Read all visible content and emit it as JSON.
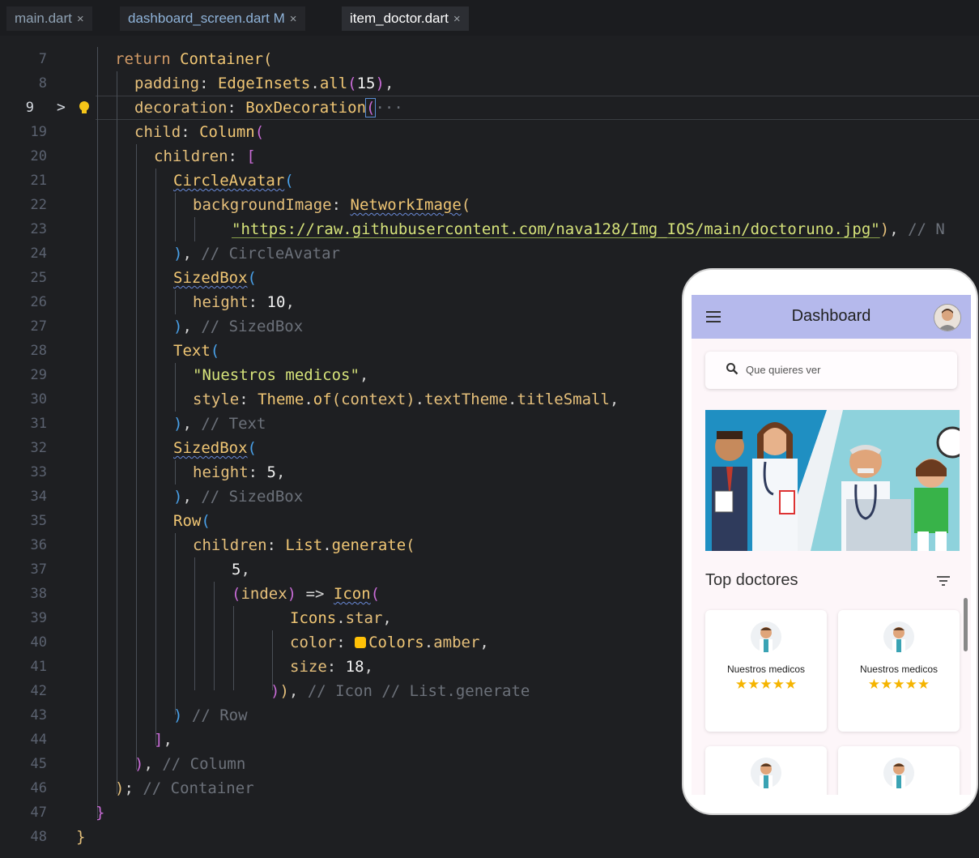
{
  "tabs": [
    {
      "name": "main.dart",
      "modified": false,
      "active": false
    },
    {
      "name": "dashboard_screen.dart",
      "status": "M",
      "modified": true,
      "active": false
    },
    {
      "name": "item_doctor.dart",
      "modified": false,
      "active": true
    }
  ],
  "tab_close_glyph": "×",
  "line_numbers": [
    "7",
    "8",
    "9",
    "19",
    "20",
    "21",
    "22",
    "23",
    "24",
    "25",
    "26",
    "27",
    "28",
    "29",
    "30",
    "31",
    "32",
    "33",
    "34",
    "35",
    "36",
    "37",
    "38",
    "39",
    "40",
    "41",
    "42",
    "43",
    "44",
    "45",
    "46",
    "47",
    "48"
  ],
  "code": {
    "l7": [
      "return",
      "Container",
      "("
    ],
    "l8": [
      "padding",
      ":",
      "EdgeInsets",
      ".",
      "all",
      "(",
      "15",
      ")",
      ","
    ],
    "l9": [
      "decoration",
      ":",
      "BoxDecoration",
      "(",
      "···"
    ],
    "l19": [
      "child",
      ":",
      "Column",
      "("
    ],
    "l20": [
      "children",
      ":",
      "["
    ],
    "l21": [
      "CircleAvatar",
      "("
    ],
    "l22": [
      "backgroundImage",
      ":",
      "NetworkImage",
      "("
    ],
    "l23": [
      "\"https://raw.githubusercontent.com/nava128/Img_IOS/main/doctoruno.jpg\"",
      ")",
      ",",
      "// N"
    ],
    "l24": [
      ")",
      ",",
      "// CircleAvatar"
    ],
    "l25": [
      "SizedBox",
      "("
    ],
    "l26": [
      "height",
      ":",
      "10",
      ","
    ],
    "l27": [
      ")",
      ",",
      "// SizedBox"
    ],
    "l28": [
      "Text",
      "("
    ],
    "l29": [
      "\"Nuestros medicos\"",
      ","
    ],
    "l30": [
      "style",
      ":",
      "Theme",
      ".",
      "of",
      "(",
      "context",
      ")",
      ".",
      "textTheme",
      ".",
      "titleSmall",
      ","
    ],
    "l31": [
      ")",
      ",",
      "// Text"
    ],
    "l32": [
      "SizedBox",
      "("
    ],
    "l33": [
      "height",
      ":",
      "5",
      ","
    ],
    "l34": [
      ")",
      ",",
      "// SizedBox"
    ],
    "l35": [
      "Row",
      "("
    ],
    "l36": [
      "children",
      ":",
      "List",
      ".",
      "generate",
      "("
    ],
    "l37": [
      "5",
      ","
    ],
    "l38": [
      "(",
      "index",
      ")",
      "=>",
      "Icon",
      "("
    ],
    "l39": [
      "Icons",
      ".",
      "star",
      ","
    ],
    "l40": [
      "color",
      ":",
      "Colors",
      ".",
      "amber",
      ","
    ],
    "l41": [
      "size",
      ":",
      "18",
      ","
    ],
    "l42": [
      ")",
      ")",
      ",",
      "// Icon // List.generate"
    ],
    "l43": [
      ")",
      "// Row"
    ],
    "l44": [
      "]",
      ","
    ],
    "l45": [
      ")",
      ",",
      "// Column"
    ],
    "l46": [
      ")",
      ";",
      "// Container"
    ],
    "l47": [
      "}"
    ],
    "l48": [
      "}"
    ]
  },
  "gutter": {
    "fold_glyph": ">",
    "lightbulb_icon": "lightbulb-icon"
  },
  "amber_swatch": "#ffc107",
  "phone": {
    "appbar_title": "Dashboard",
    "appbar_color": "#b5b9ec",
    "search_placeholder": "Que quieres ver",
    "section_title": "Top doctores",
    "cards": [
      {
        "name": "Nuestros medicos",
        "stars": "★★★★★"
      },
      {
        "name": "Nuestros medicos",
        "stars": "★★★★★"
      },
      {
        "name": "",
        "stars": ""
      },
      {
        "name": "",
        "stars": ""
      }
    ],
    "star_color": "#f5b400"
  }
}
